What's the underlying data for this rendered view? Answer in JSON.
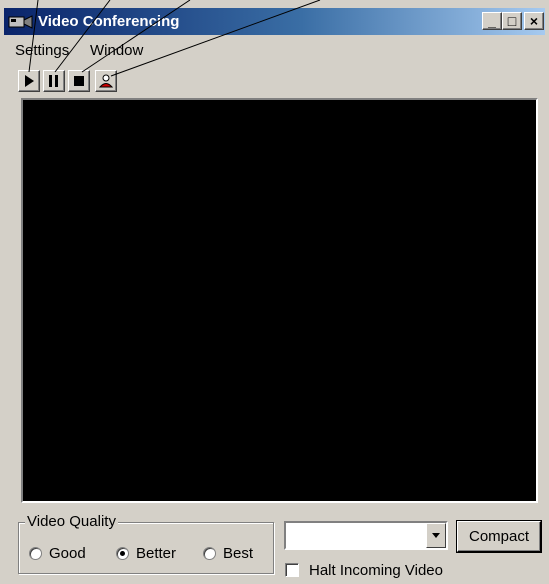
{
  "window": {
    "title": "Video Conferencing",
    "title_gradient": [
      "#0a246a",
      "#a6caf0"
    ],
    "caption_buttons": [
      {
        "name": "minimize",
        "label": "_"
      },
      {
        "name": "maximize",
        "label": "□"
      },
      {
        "name": "close",
        "label": "×"
      }
    ]
  },
  "menu": {
    "items": [
      "Settings",
      "Window"
    ]
  },
  "toolbar": {
    "buttons": [
      {
        "name": "play",
        "icon": "play-icon"
      },
      {
        "name": "pause",
        "icon": "pause-icon"
      },
      {
        "name": "stop",
        "icon": "stop-icon"
      },
      {
        "name": "contact",
        "icon": "person-icon"
      }
    ]
  },
  "video": {
    "background": "#000000"
  },
  "quality": {
    "legend": "Video Quality",
    "options": [
      {
        "label": "Good",
        "checked": false
      },
      {
        "label": "Better",
        "checked": true
      },
      {
        "label": "Best",
        "checked": false
      }
    ]
  },
  "controls": {
    "combo_value": "",
    "compact_label": "Compact",
    "halt_label": "Halt Incoming Video",
    "halt_checked": false
  }
}
